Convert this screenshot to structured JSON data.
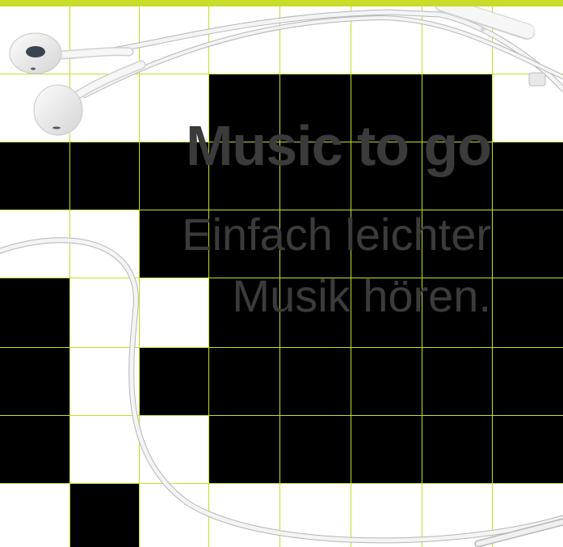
{
  "headline": "Music to go",
  "subline": {
    "line1": "Einfach leichter",
    "line2": "Musik hören."
  },
  "image": {
    "subject": "white-earphones-icon"
  },
  "colors": {
    "accent": "#c8dc2a",
    "grid_line": "#c8dc2a",
    "block": "#000000",
    "background": "#ffffff",
    "text": "#3b3b3b"
  }
}
